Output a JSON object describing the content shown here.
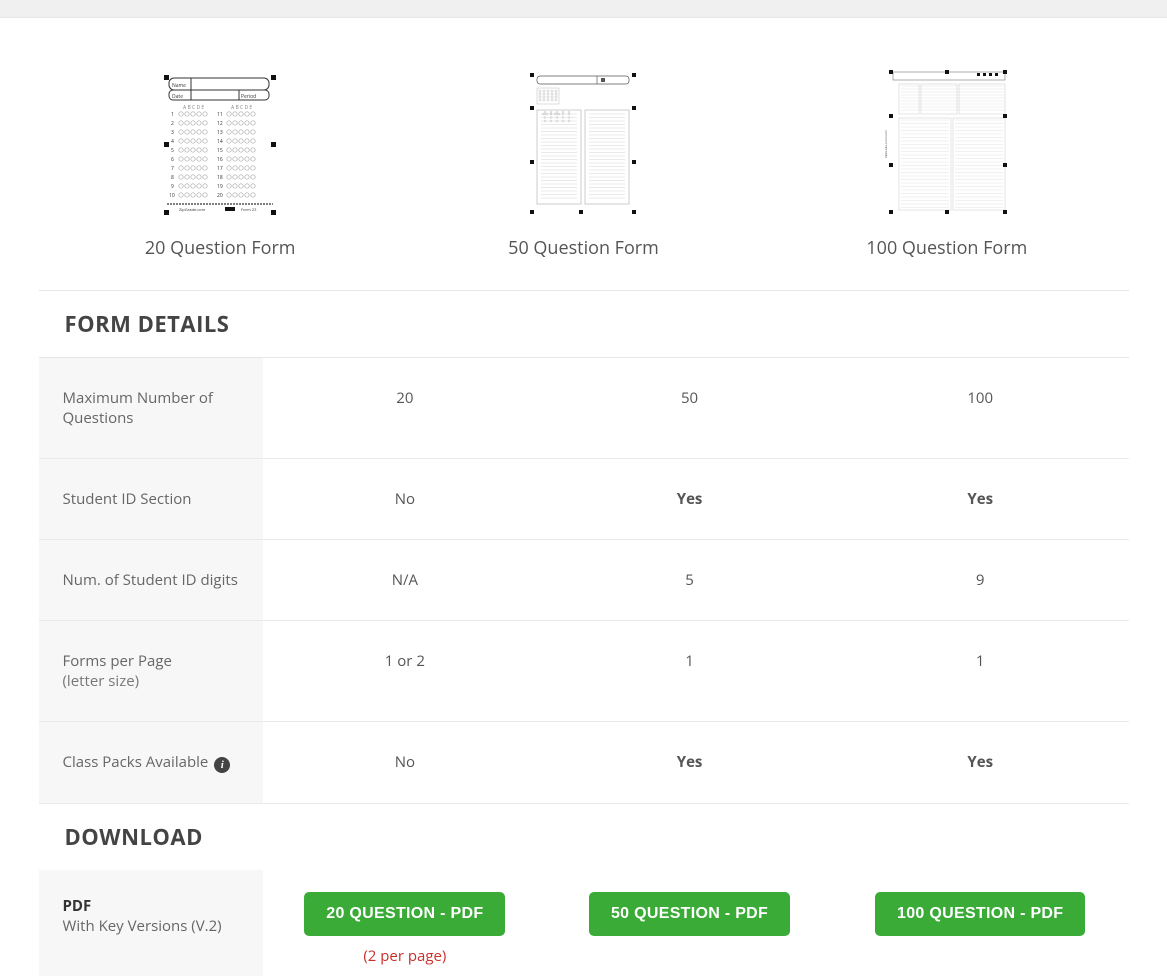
{
  "forms": [
    {
      "label": "20 Question Form"
    },
    {
      "label": "50 Question Form"
    },
    {
      "label": "100 Question Form"
    }
  ],
  "sections": {
    "details_header": "FORM DETAILS",
    "download_header": "DOWNLOAD"
  },
  "rows": {
    "max_q": {
      "label": "Maximum Number of Questions",
      "v20": "20",
      "v50": "50",
      "v100": "100"
    },
    "student_id": {
      "label": "Student ID Section",
      "v20": "No",
      "v50": "Yes",
      "v100": "Yes"
    },
    "id_digits": {
      "label": "Num. of Student ID digits",
      "v20": "N/A",
      "v50": "5",
      "v100": "9"
    },
    "per_page": {
      "label": "Forms per Page",
      "sublabel": "(letter size)",
      "v20": "1 or 2",
      "v50": "1",
      "v100": "1"
    },
    "class_packs": {
      "label": "Class Packs Available",
      "v20": "No",
      "v50": "Yes",
      "v100": "Yes"
    }
  },
  "download": {
    "pdf_title": "PDF",
    "pdf_sub": "With Key Versions (V.2)",
    "btn20": "20 QUESTION - PDF",
    "btn50": "50 QUESTION - PDF",
    "btn100": "100 QUESTION - PDF",
    "note20": "(2 per page)"
  }
}
